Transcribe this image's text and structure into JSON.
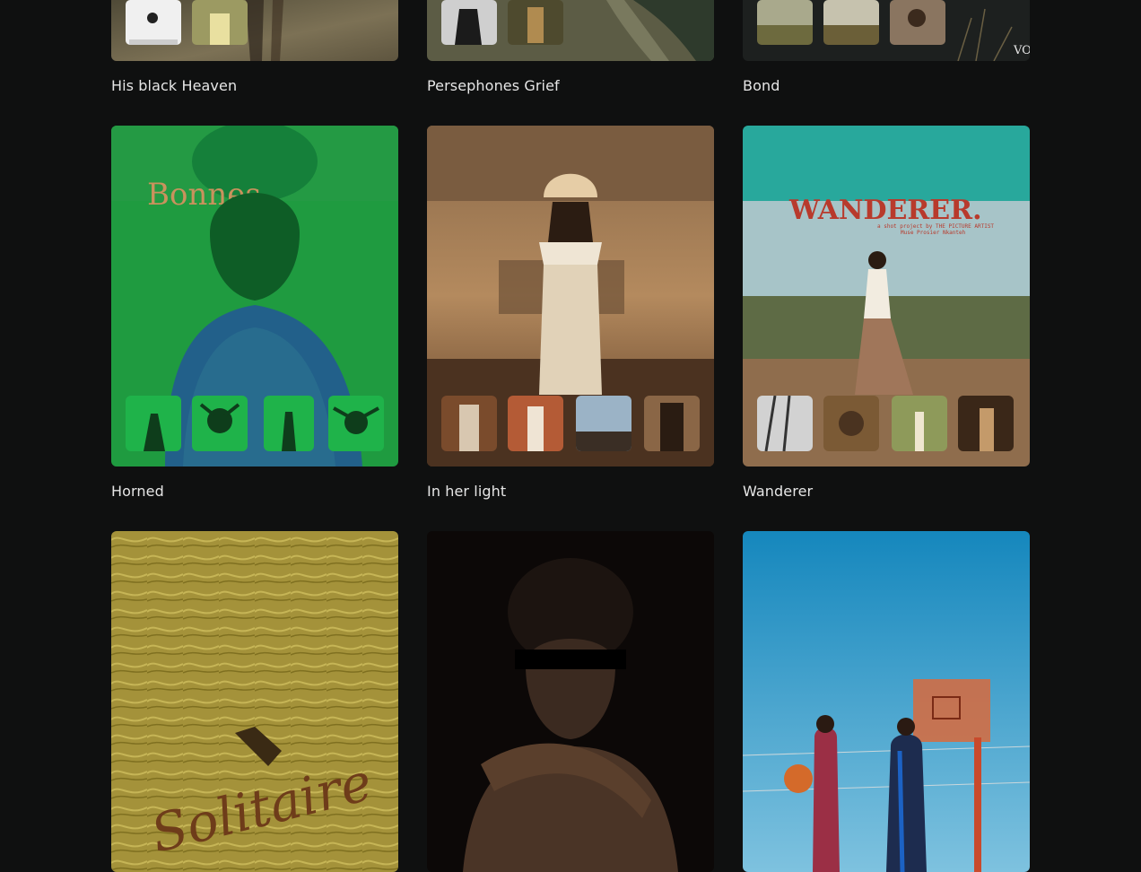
{
  "projects": [
    {
      "title": "His black Heaven",
      "palette": [
        "#5e5540",
        "#7b6f52",
        "#2b2a24"
      ]
    },
    {
      "title": "Persephones Grief",
      "palette": [
        "#6a6b50",
        "#3a3b2e",
        "#8a8a72"
      ]
    },
    {
      "title": "Bond",
      "palette": [
        "#2c2e2c",
        "#1b1d1c",
        "#55503c"
      ]
    },
    {
      "title": "Horned",
      "palette": [
        "#1f9d43",
        "#127a34",
        "#0f6a2d"
      ]
    },
    {
      "title": "In her light",
      "palette": [
        "#8a6a4a",
        "#c7a27c",
        "#4e3522"
      ]
    },
    {
      "title": "Wanderer",
      "palette": [
        "#28a89c",
        "#a8c3c7",
        "#8f6d4d"
      ]
    },
    {
      "title": "",
      "palette": [
        "#a39133",
        "#857522",
        "#c3b14e"
      ]
    },
    {
      "title": "",
      "palette": [
        "#0d0908",
        "#3a2a20",
        "#1a1210"
      ]
    },
    {
      "title": "",
      "palette": [
        "#1a8ec2",
        "#5ab3db",
        "#9d3b4a"
      ]
    }
  ],
  "overlays": {
    "bond_badge": "VO",
    "wanderer_headline": "WANDERER.",
    "wanderer_sub": "a shot project by THE PICTURE ARTIST",
    "wanderer_sub2": "Muse Prosier Nkanteh",
    "horned_headline": "Bonnes",
    "solitaire_script": "Solitaire"
  }
}
